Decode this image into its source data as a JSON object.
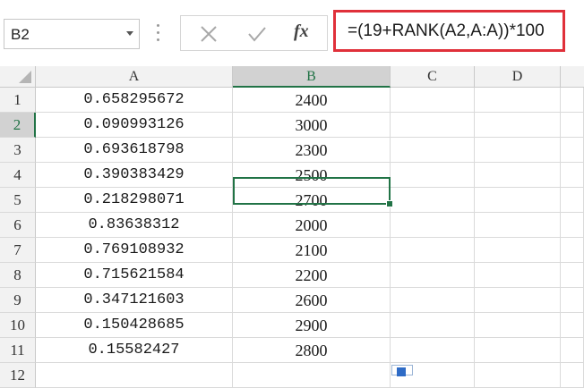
{
  "name_box": {
    "value": "B2"
  },
  "formula_bar": {
    "cancel_icon": "close-icon",
    "enter_icon": "check-icon",
    "function_label": "fx",
    "formula": "=(19+RANK(A2,A:A))*100"
  },
  "sheet": {
    "columns": [
      "A",
      "B",
      "C",
      "D"
    ],
    "active_column": "B",
    "active_row": "2",
    "active_cell": "B2",
    "rows": [
      {
        "num": "1",
        "a": "0.658295672",
        "b": "2400"
      },
      {
        "num": "2",
        "a": "0.090993126",
        "b": "3000"
      },
      {
        "num": "3",
        "a": "0.693618798",
        "b": "2300"
      },
      {
        "num": "4",
        "a": "0.390383429",
        "b": "2500"
      },
      {
        "num": "5",
        "a": "0.218298071",
        "b": "2700"
      },
      {
        "num": "6",
        "a": "0.83638312",
        "b": "2000"
      },
      {
        "num": "7",
        "a": "0.769108932",
        "b": "2100"
      },
      {
        "num": "8",
        "a": "0.715621584",
        "b": "2200"
      },
      {
        "num": "9",
        "a": "0.347121603",
        "b": "2600"
      },
      {
        "num": "10",
        "a": "0.150428685",
        "b": "2900"
      },
      {
        "num": "11",
        "a": "0.15582427",
        "b": "2800"
      },
      {
        "num": "12",
        "a": "",
        "b": ""
      }
    ]
  },
  "colors": {
    "selection": "#217346",
    "formula_highlight": "#e0303a"
  }
}
